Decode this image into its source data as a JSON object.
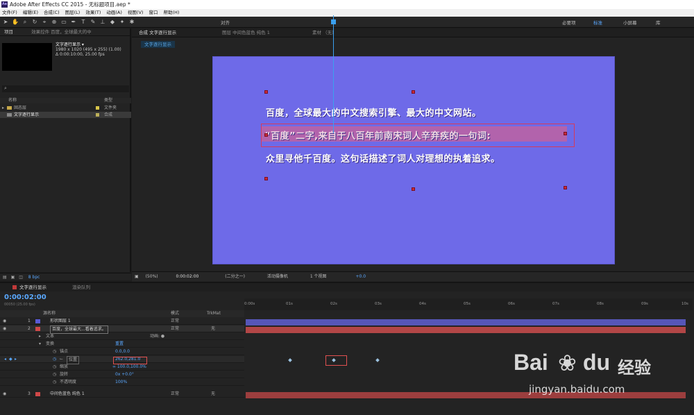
{
  "window": {
    "title": "Adobe After Effects CC 2015 - 无标题项目.aep *",
    "app_badge": "Ae"
  },
  "menu": [
    "文件(F)",
    "编辑(E)",
    "合成(C)",
    "图层(L)",
    "效果(T)",
    "动画(A)",
    "视图(V)",
    "窗口",
    "帮助(H)"
  ],
  "toolbar": {
    "align_label": "对齐",
    "workspaces": [
      "必要项",
      "标准",
      "小屏幕",
      "库"
    ]
  },
  "project": {
    "tab": "项目",
    "effects_tab": "效果控件 百度，全球最大的中",
    "comp_name": "文字逐行显示 ▾",
    "comp_size": "1980 x 1020  (495 x 255) (1.00)",
    "comp_duration": "Δ 0:00:10:00, 25.00 fps",
    "search_icon": "⌕",
    "col_name": "名称",
    "col_type": "类型",
    "items": [
      {
        "name": "固态层",
        "type": "文件夹"
      },
      {
        "name": "文字逐行显示",
        "type": "合成"
      }
    ],
    "bpc": "8 bpc"
  },
  "composition": {
    "tab_label": "合成 文字逐行显示",
    "tab_layer": "图层 中间色蓝色 纯色 1",
    "tab_footage": "素材 （无）",
    "comp_tab": "文字逐行显示",
    "lines": [
      "百度，全球最大的中文搜索引擎、最大的中文网站。",
      "“百度”二字,来自于八百年前南宋词人辛弃疾的一句词:",
      "众里寻他千百度。这句话描述了词人对理想的执着追求。"
    ],
    "zoom": "(50%)",
    "timecode": "0:00:02:00",
    "resolution": "(二分之一)",
    "camera": "活动摄像机",
    "views": "1 个视图",
    "exposure": "+0.0",
    "colors": {
      "bg": "#6e6ae8",
      "selection": "#d63a5a"
    }
  },
  "timeline": {
    "tab": "文字逐行显示",
    "render_tab": "渲染队列",
    "timecode": "0:00:02:00",
    "fps": "00050 (25.00 fps)",
    "cols": {
      "name": "源名称",
      "mode": "模式",
      "trkmat": "TrkMat"
    },
    "layers": [
      {
        "num": "1",
        "name": "形状图层 1",
        "mode": "正常",
        "color": "#5a5ad6"
      },
      {
        "num": "2",
        "name": "百度，全球最大...看着追求。",
        "mode": "正常",
        "trk": "无",
        "color": "#d04848"
      },
      {
        "num": "",
        "name": "文本",
        "anim": "动画: ●"
      },
      {
        "num": "",
        "name": "变换",
        "value": "重置"
      },
      {
        "num": "",
        "name": "锚点",
        "value": "0.0,0.0"
      },
      {
        "num": "",
        "name": "位置",
        "value": "262.0,281.0"
      },
      {
        "num": "",
        "name": "缩放",
        "value": "∞ 100.0,100.0%"
      },
      {
        "num": "",
        "name": "旋转",
        "value": "0x +0.0°"
      },
      {
        "num": "",
        "name": "不透明度",
        "value": "100%"
      },
      {
        "num": "3",
        "name": "中间色蓝色 纯色 1",
        "mode": "正常",
        "trk": "无",
        "color": "#d04848"
      }
    ],
    "ruler": [
      "0:00s",
      "01s",
      "02s",
      "03s",
      "04s",
      "05s",
      "06s",
      "07s",
      "08s",
      "09s",
      "10s"
    ]
  },
  "watermark": {
    "brand": "Bai",
    "brand2": "du",
    "cn": "经验",
    "url": "jingyan.baidu.com"
  }
}
